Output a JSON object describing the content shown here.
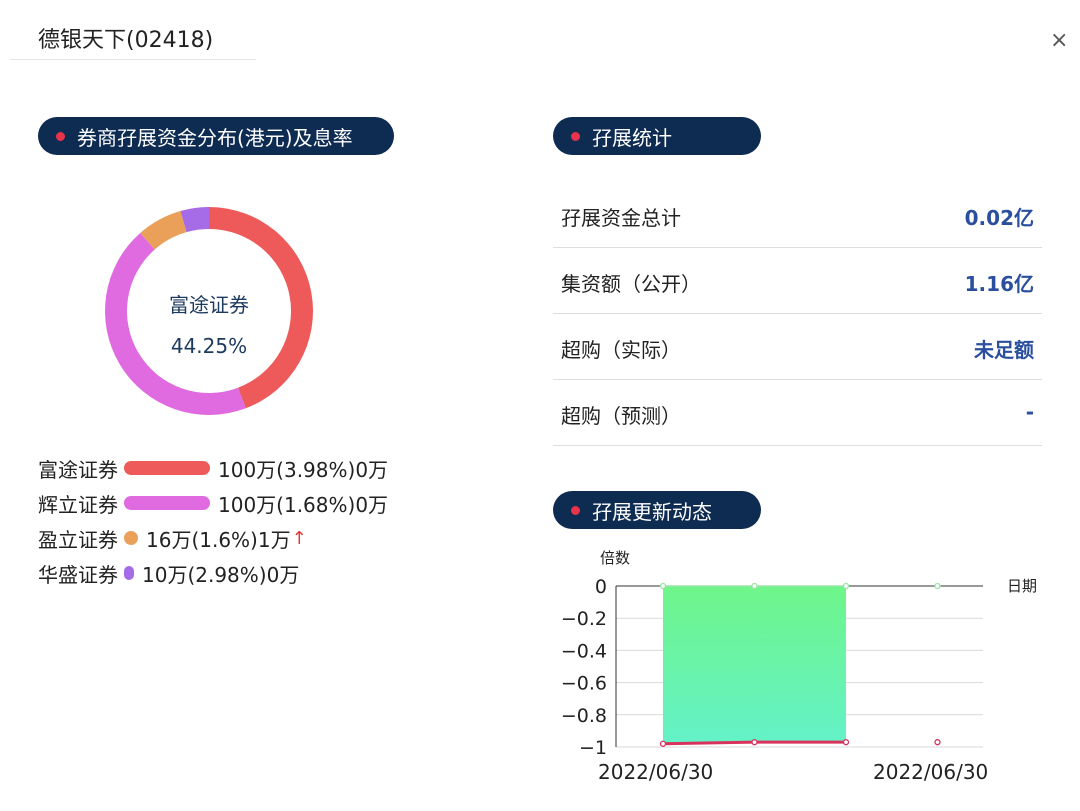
{
  "header": {
    "title": "德银天下(02418)",
    "close_label": "×"
  },
  "distribution": {
    "heading": "券商孖展资金分布(港元)及息率",
    "center_name": "富途证券",
    "center_pct": "44.25%",
    "brokers": [
      {
        "name": "富途证券",
        "detail": "100万(3.98%)0万",
        "arrow": "",
        "share": 0.4425,
        "color": "#ee5a5a"
      },
      {
        "name": "辉立证券",
        "detail": "100万(1.68%)0万",
        "arrow": "",
        "share": 0.4425,
        "color": "#e06ae0"
      },
      {
        "name": "盈立证券",
        "detail": "16万(1.6%)1万",
        "arrow": "↑",
        "share": 0.0708,
        "color": "#eba05a"
      },
      {
        "name": "华盛证券",
        "detail": "10万(2.98%)0万",
        "arrow": "",
        "share": 0.0442,
        "color": "#a66be6"
      }
    ]
  },
  "stats": {
    "heading": "孖展统计",
    "rows": [
      {
        "label": "孖展资金总计",
        "value": "0.02亿"
      },
      {
        "label": "集资额（公开）",
        "value": "1.16亿"
      },
      {
        "label": "超购（实际）",
        "value": "未足额"
      },
      {
        "label": "超购（预测）",
        "value": "-"
      }
    ]
  },
  "updates": {
    "heading": "孖展更新动态",
    "chart_data": {
      "type": "area",
      "ylabel": "倍数",
      "xlabel": "日期",
      "ylim": [
        -1,
        0
      ],
      "yticks": [
        0,
        -0.2,
        -0.4,
        -0.6,
        -0.8,
        -1
      ],
      "ytick_labels": [
        "0",
        "−0.2",
        "−0.4",
        "−0.6",
        "−0.8",
        "−1"
      ],
      "xtick_labels": [
        "2022/06/30",
        "2022/06/30"
      ],
      "grid": true,
      "series": [
        {
          "values": [
            0,
            0,
            0,
            0
          ],
          "color": "#9be3a6"
        },
        {
          "values": [
            -0.98,
            -0.97,
            -0.97,
            -0.97
          ],
          "color": "#d9335d"
        }
      ]
    }
  }
}
